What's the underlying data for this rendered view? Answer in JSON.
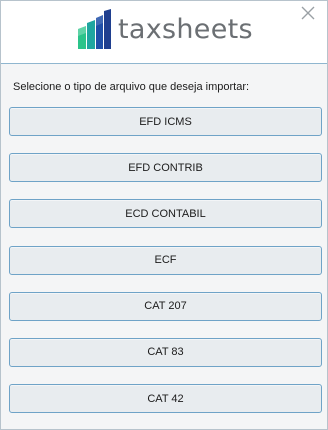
{
  "window": {
    "logo_text_prefix": "tax",
    "logo_text_suffix": "sheets",
    "close_icon": "close-icon",
    "logo_icon": "bar-chart-logo-icon"
  },
  "colors": {
    "logo_green": "#2bc48a",
    "logo_blue": "#1f4fa8",
    "logo_teal": "#1fa6a0",
    "button_border": "#6fa3c7",
    "button_fill": "#e8ecef",
    "header_divider": "#8fb6cf"
  },
  "prompt_text": "Selecione o tipo de arquivo que deseja importar:",
  "buttons": [
    {
      "label": "EFD ICMS"
    },
    {
      "label": "EFD CONTRIB"
    },
    {
      "label": "ECD CONTABIL"
    },
    {
      "label": "ECF"
    },
    {
      "label": "CAT 207"
    },
    {
      "label": "CAT 83"
    },
    {
      "label": "CAT 42"
    }
  ]
}
